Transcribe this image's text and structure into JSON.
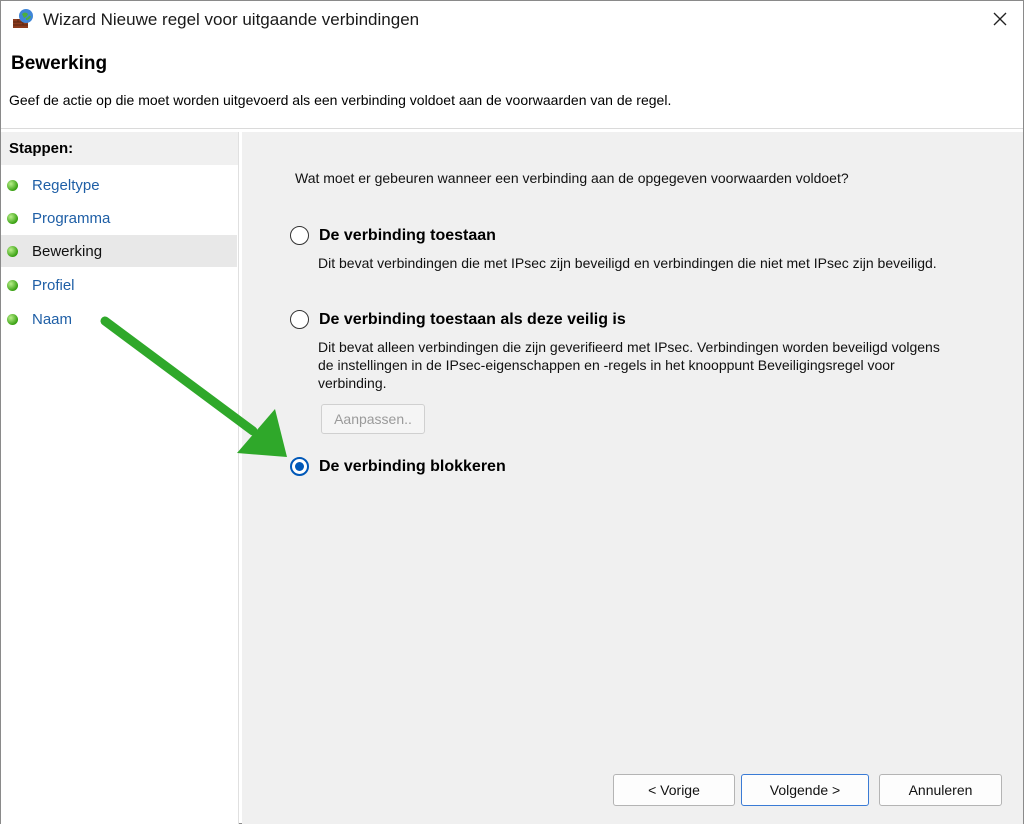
{
  "window": {
    "title": "Wizard Nieuwe regel voor uitgaande verbindingen",
    "icon": "firewall-icon"
  },
  "header": {
    "title": "Bewerking",
    "description": "Geef de actie op die moet worden uitgevoerd als een verbinding voldoet aan de voorwaarden van de regel."
  },
  "sidebar": {
    "title": "Stappen:",
    "items": [
      {
        "label": "Regeltype",
        "active": false
      },
      {
        "label": "Programma",
        "active": false
      },
      {
        "label": "Bewerking",
        "active": true
      },
      {
        "label": "Profiel",
        "active": false
      },
      {
        "label": "Naam",
        "active": false
      }
    ]
  },
  "main": {
    "question": "Wat moet er gebeuren wanneer een verbinding aan de opgegeven voorwaarden voldoet?",
    "options": [
      {
        "label": "De verbinding toestaan",
        "description": "Dit bevat verbindingen die met IPsec zijn beveiligd en verbindingen die niet met IPsec zijn beveiligd.",
        "checked": false
      },
      {
        "label": "De verbinding toestaan als deze veilig is",
        "description": "Dit bevat alleen verbindingen die zijn geverifieerd met IPsec. Verbindingen worden beveiligd volgens de instellingen in de IPsec-eigenschappen en -regels in het knooppunt Beveiligingsregel voor verbinding.",
        "checked": false
      },
      {
        "label": "De verbinding blokkeren",
        "description": "",
        "checked": true
      }
    ],
    "customize_button": "Aanpassen.."
  },
  "footer": {
    "back": "< Vorige",
    "next": "Volgende >",
    "cancel": "Annuleren"
  },
  "annotation": {
    "arrow_color": "#2fa82a"
  }
}
